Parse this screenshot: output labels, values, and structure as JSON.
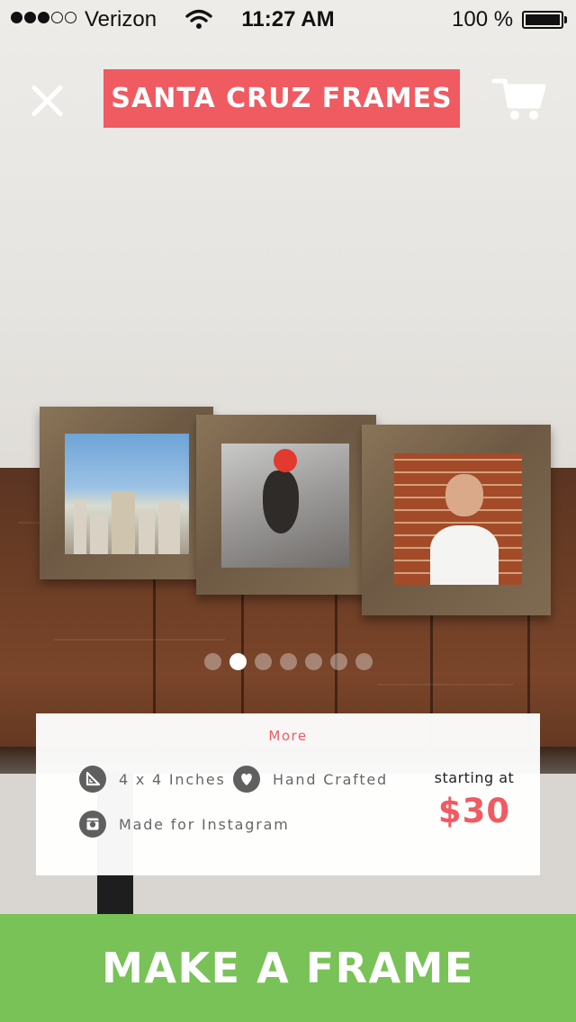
{
  "status_bar": {
    "carrier": "Verizon",
    "time": "11:27 AM",
    "battery_percent": "100 %",
    "battery_level": 1.0,
    "signal_bars_filled": 3,
    "signal_bars_total": 5
  },
  "header": {
    "title": "SANTA CRUZ FRAMES",
    "close_icon": "close-icon",
    "cart_icon": "cart-icon"
  },
  "carousel": {
    "page_count": 7,
    "active_index": 1
  },
  "info": {
    "more_label": "More",
    "features": [
      {
        "icon": "ruler-triangle-icon",
        "label": "4 x 4 Inches"
      },
      {
        "icon": "heart-icon",
        "label": "Hand Crafted"
      },
      {
        "icon": "instagram-icon",
        "label": "Made for Instagram"
      }
    ],
    "price_label": "starting at",
    "price": "$30"
  },
  "cta": {
    "label": "MAKE A FRAME"
  },
  "colors": {
    "accent_red": "#ef5b61",
    "cta_green": "#78c257"
  }
}
